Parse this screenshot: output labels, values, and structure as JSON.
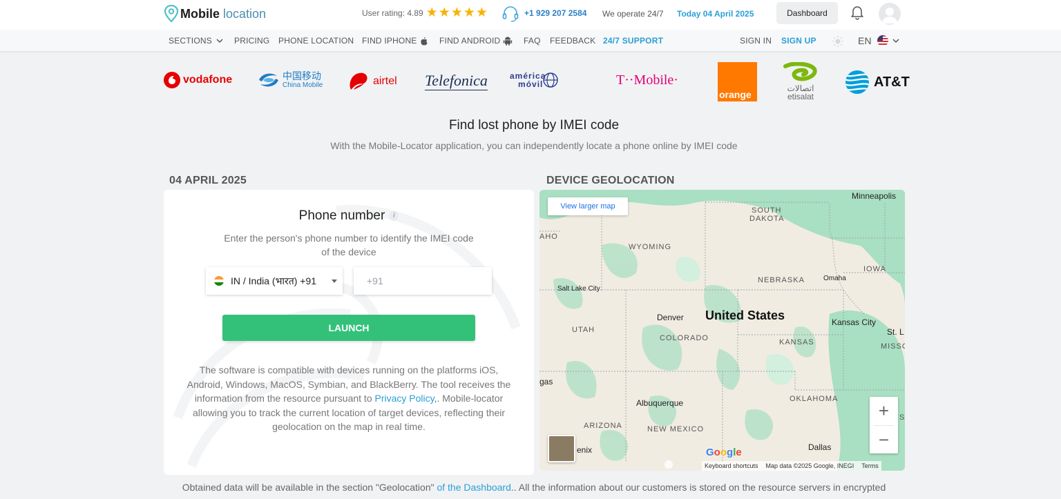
{
  "header": {
    "brand": "Mobile",
    "brand_sub": "location",
    "rating_text": "User rating: 4.89",
    "phone": "+1 929 207 2584",
    "operate": "We operate 24/7",
    "today": "Today 04 April 2025",
    "dashboard_label": "Dashboard"
  },
  "nav": {
    "sections": "SECTIONS",
    "pricing": "PRICING",
    "phone_location": "PHONE LOCATION",
    "find_iphone": "FIND IPHONE",
    "find_android": "FIND ANDROID",
    "faq": "FAQ",
    "feedback": "FEEDBACK",
    "support": "24/7 SUPPORT",
    "sign_in": "SIGN IN",
    "sign_up": "SIGN UP",
    "lang": "EN"
  },
  "carriers": {
    "vodafone": "vodafone",
    "china_mobile_cn": "中国移动",
    "china_mobile_en": "China Mobile",
    "airtel": "airtel",
    "telefonica": "Telefonica",
    "america_1": "américa",
    "america_2": "móvil",
    "tmobile": "T··Mobile·",
    "orange": "orange",
    "etisalat_ar": "اتصالات",
    "etisalat_en": "etisalat",
    "att": "AT&T"
  },
  "hero": {
    "title": "Find lost phone by IMEI code",
    "subtitle": "With the Mobile-Locator application, you can independently locate a phone online by IMEI code"
  },
  "left": {
    "date_label": "04 APRIL 2025",
    "phone_title": "Phone number",
    "info": "i",
    "phone_desc": "Enter the person's phone number to identify the IMEI code of the device",
    "country": "IN / India (भारत) +91",
    "phone_placeholder": "+91",
    "launch": "LAUNCH",
    "compat_1": "The software is compatible with devices running on the platforms iOS, Android, Windows, MacOS, Symbian, and BlackBerry. The tool receives the information from the resource pursuant to ",
    "privacy": "Privacy Policy",
    "compat_2": ",. Mobile-locator allowing you to track the current location of target devices, reflecting their geolocation on the map in real time."
  },
  "map": {
    "section_label": "DEVICE GEOLOCATION",
    "larger_map": "View larger map",
    "labels": {
      "minneapolis": "Minneapolis",
      "south_dakota_1": "SOUTH",
      "south_dakota_2": "DAKOTA",
      "aho": "AHO",
      "wyoming": "WYOMING",
      "iowa": "IOWA",
      "nebraska": "NEBRASKA",
      "omaha": "Omaha",
      "salt_lake": "Salt Lake City",
      "denver": "Denver",
      "united_states": "United States",
      "kansas_city": "Kansas City",
      "st_l": "St. L",
      "utah": "UTAH",
      "colorado": "COLORADO",
      "kansas": "KANSAS",
      "missouri": "MISSOU",
      "gas": "gas",
      "albuquerque": "Albuquerque",
      "oklahoma": "OKLAHOMA",
      "arizona": "ARIZONA",
      "new_mexico": "NEW MEXICO",
      "phoenix": "enix",
      "dallas": "Dallas",
      "s": "S"
    },
    "zoom_in": "+",
    "zoom_out": "−",
    "google": [
      "G",
      "o",
      "o",
      "g",
      "l",
      "e"
    ],
    "footer_shortcuts": "Keyboard shortcuts",
    "footer_data": "Map data ©2025 Google, INEGI",
    "footer_terms": "Terms"
  },
  "bottom": {
    "pre": "Obtained data will be available in the section \"Geolocation\" ",
    "link": "of the Dashboard",
    "post": ".. All the information about our customers is stored on the resource servers in encrypted"
  },
  "colors": {
    "accent": "#2b9fd6",
    "launch": "#33c17a",
    "star": "#f5b301"
  }
}
